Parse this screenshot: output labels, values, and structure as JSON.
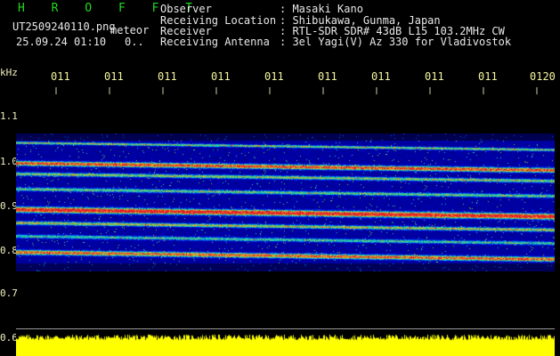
{
  "header": {
    "title": "H R O F F T",
    "file_name": "UT2509240110.png",
    "mode": "meteor",
    "datetime": "25.09.24 01:10",
    "counter": "0..",
    "labels": [
      "Observer",
      "Receiving Location",
      "Receiver",
      "Receiving Antenna"
    ],
    "values": [
      ": Masaki Kano",
      ": Shibukawa, Gunma, Japan",
      ": RTL-SDR SDR# 43dB L15 103.2MHz CW",
      ": 3el Yagi(V) Az 330 for Vladivostok"
    ]
  },
  "axis": {
    "unit": "kHz",
    "time_ticks": [
      "011",
      "011",
      "011",
      "011",
      "011",
      "011",
      "011",
      "011",
      "011",
      "0120"
    ],
    "freq_ticks": [
      "1.1",
      "1.0",
      "0.9",
      "0.8",
      "0.7",
      "0.6"
    ]
  },
  "colors": {
    "background": "#000000",
    "title": "#22d822",
    "text": "#e8e8e8",
    "tick": "#f5f5a0",
    "noise_floor": "#ffff00"
  }
}
